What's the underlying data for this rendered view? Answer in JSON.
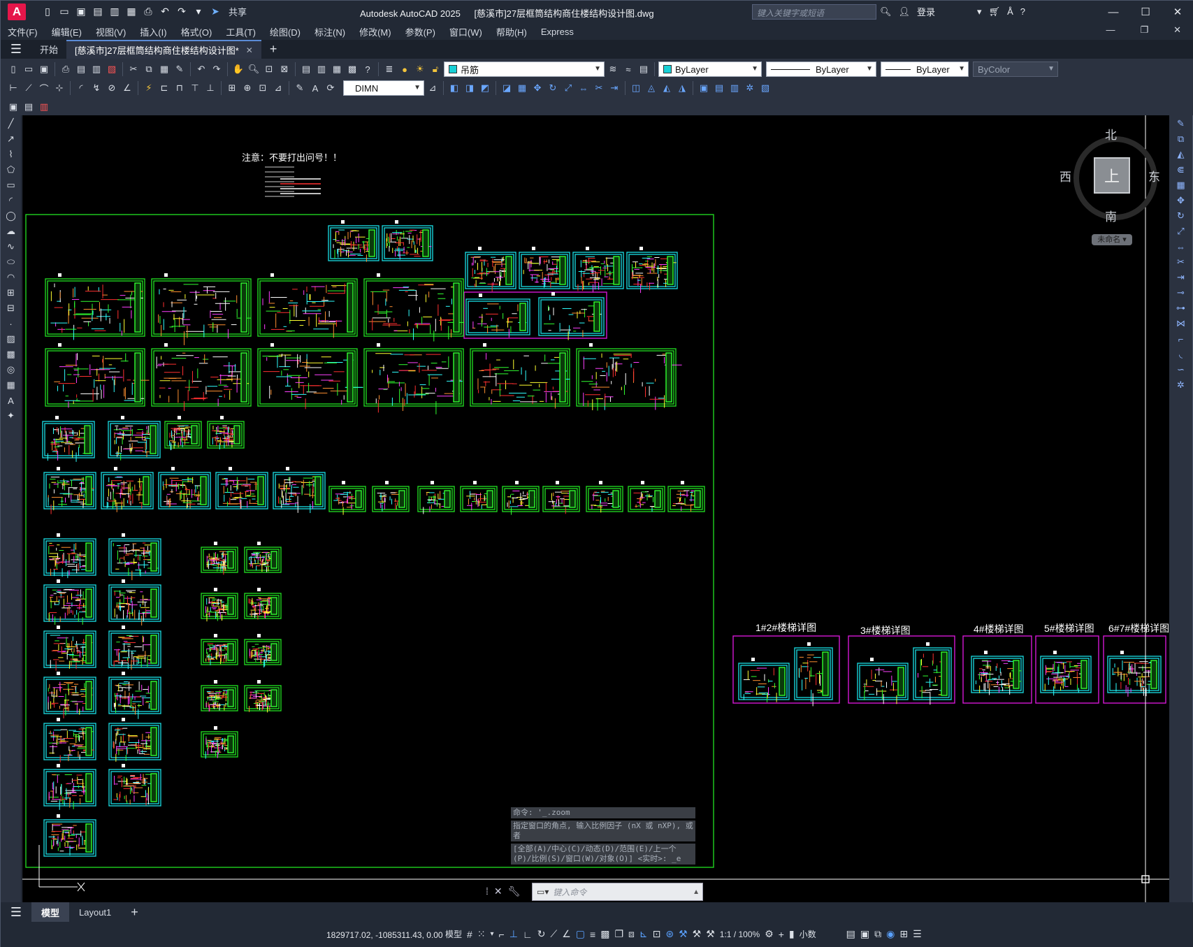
{
  "app": {
    "title": "Autodesk AutoCAD 2025",
    "document": "[慈溪市]27层框筒结构商住楼结构设计图.dwg",
    "logo_letter": "A"
  },
  "qat": {
    "share": "共享"
  },
  "search": {
    "placeholder": "键入关键字或短语"
  },
  "user": {
    "login": "登录"
  },
  "menu": [
    "文件(F)",
    "编辑(E)",
    "视图(V)",
    "插入(I)",
    "格式(O)",
    "工具(T)",
    "绘图(D)",
    "标注(N)",
    "修改(M)",
    "参数(P)",
    "窗口(W)",
    "帮助(H)",
    "Express"
  ],
  "tabs": {
    "start": "开始",
    "document": "[慈溪市]27层框筒结构商住楼结构设计图*"
  },
  "properties": {
    "layer": "吊筋",
    "color": "ByLayer",
    "linetype": "ByLayer",
    "lineweight": "ByLayer",
    "plotstyle": "ByColor",
    "dimstyle": "DIMN"
  },
  "drawing": {
    "note": "注意：不要打出问号！！",
    "stair_titles": [
      "1#2#楼梯详图",
      "3#楼梯详图",
      "4#楼梯详图",
      "5#楼梯详图",
      "6#7#楼梯详图"
    ]
  },
  "viewcube": {
    "north": "北",
    "south": "南",
    "east": "东",
    "west": "西",
    "top": "上",
    "wcs": "未命名"
  },
  "command": {
    "history": [
      "命令: '_.zoom",
      "指定窗口的角点, 输入比例因子 (nX 或 nXP), 或者",
      "[全部(A)/中心(C)/动态(D)/范围(E)/上一个(P)/比例(S)/窗口(W)/对象(O)] <实时>: _e"
    ],
    "placeholder": "键入命令"
  },
  "layout_tabs": {
    "model": "模型",
    "layout1": "Layout1"
  },
  "status": {
    "coords": "1829717.02, -1085311.43, 0.00",
    "model": "模型",
    "scale": "1:1 / 100%",
    "units": "小数"
  },
  "colors": {
    "accent": "#5b8bd6",
    "logo": "#e5164a",
    "frame_green": "#1fd21f",
    "frame_cyan": "#18d0d6",
    "frame_magenta": "#d318d3"
  }
}
